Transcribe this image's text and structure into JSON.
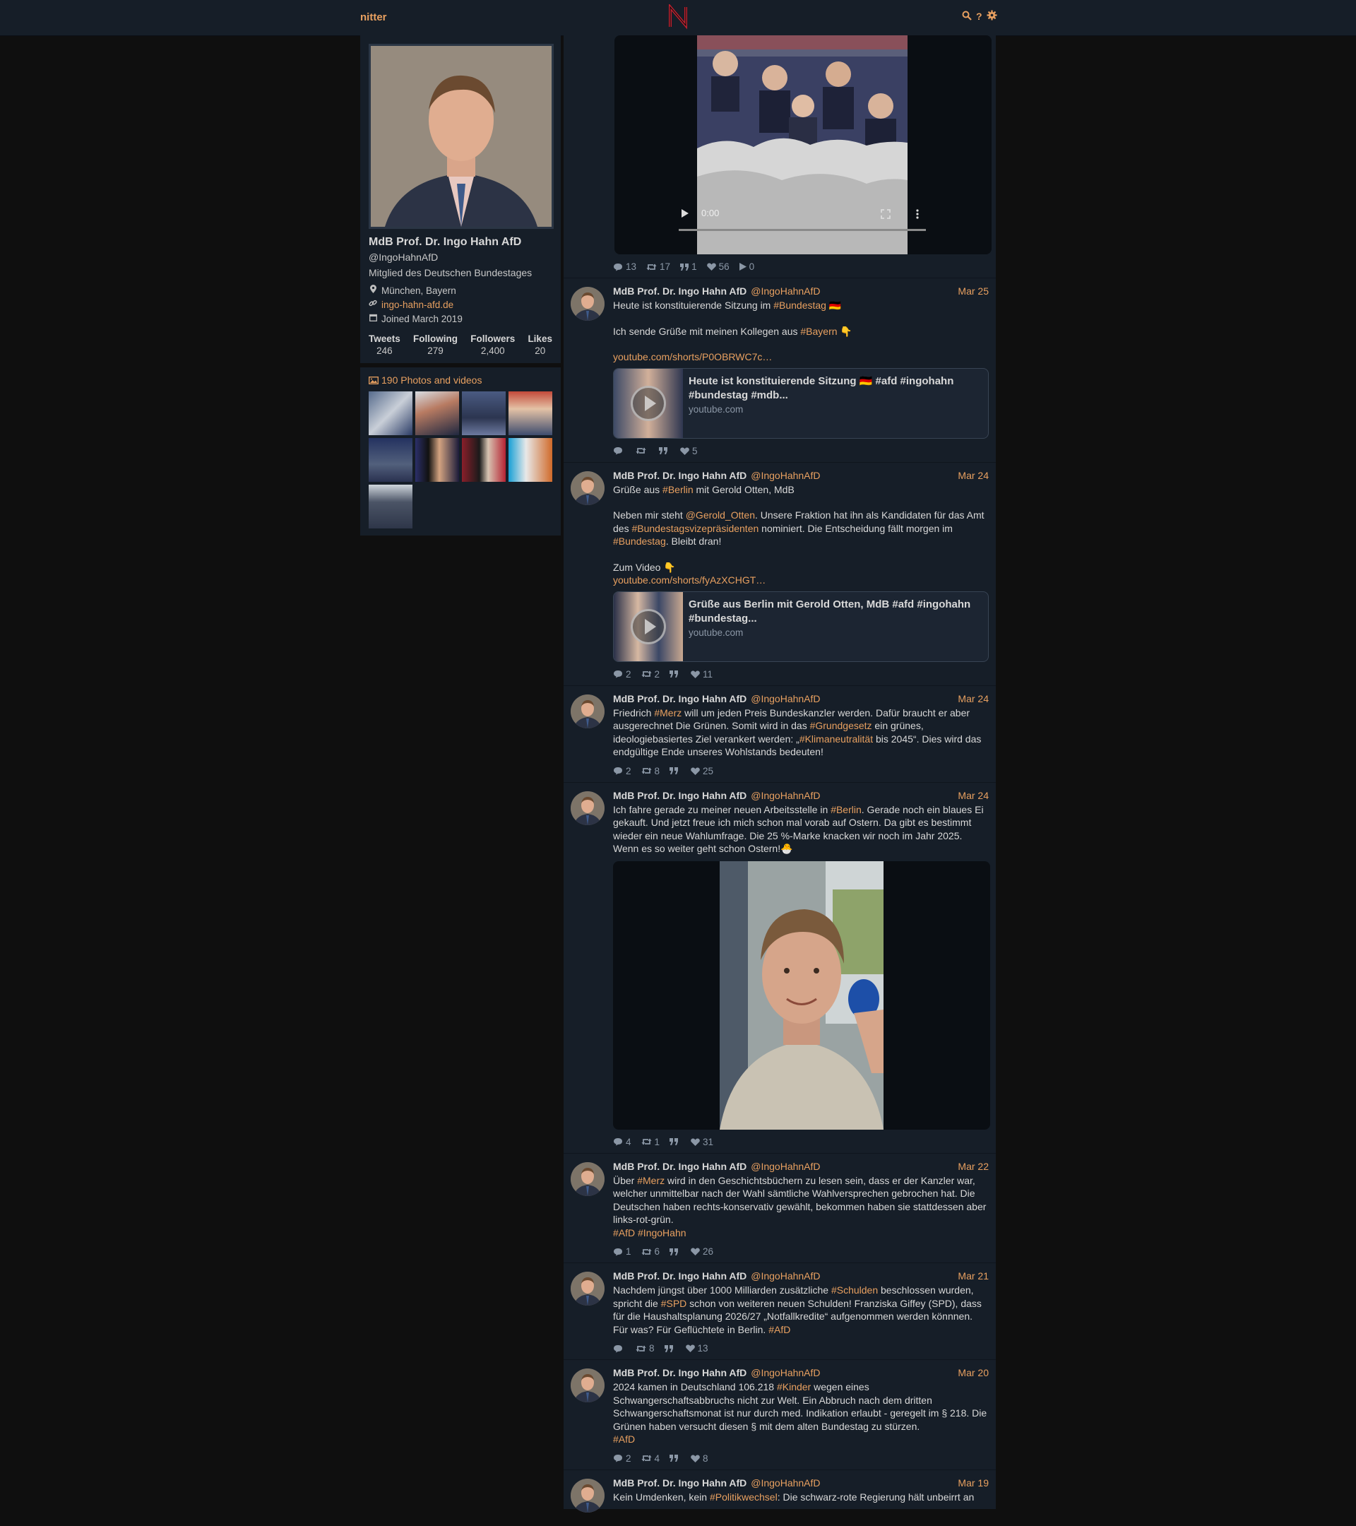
{
  "nav": {
    "brand": "nitter",
    "logo": "N",
    "icons": [
      "search-icon",
      "help-icon",
      "settings-icon"
    ],
    "help_glyph": "?",
    "search_glyph": "🔍",
    "settings_glyph": "⚙"
  },
  "profile": {
    "name": "MdB Prof. Dr. Ingo Hahn AfD",
    "handle": "@IngoHahnAfD",
    "bio": "Mitglied des Deutschen Bundestages",
    "location": "München, Bayern",
    "website": "ingo-hahn-afd.de",
    "joined": "Joined March 2019",
    "stats": [
      {
        "label": "Tweets",
        "value": "246"
      },
      {
        "label": "Following",
        "value": "279"
      },
      {
        "label": "Followers",
        "value": "2,400"
      },
      {
        "label": "Likes",
        "value": "20"
      }
    ],
    "media_title": "190 Photos and videos"
  },
  "video_tweet": {
    "time": "0:00",
    "stats": {
      "replies": "13",
      "retweets": "17",
      "quotes": "1",
      "likes": "56",
      "plays": "0"
    }
  },
  "tweets": [
    {
      "name": "MdB Prof. Dr. Ingo Hahn AfD",
      "handle": "@IngoHahnAfD",
      "date": "Mar 25",
      "p1": "Heute ist konstituierende Sitzung im ",
      "p1_tag": "#Bundestag",
      "p1_end": " 🇩🇪",
      "p2": "Ich sende Grüße mit meinen Kollegen aus ",
      "p2_tag": "#Bayern",
      "p2_end": " 👇",
      "link": "youtube.com/shorts/P0OBRWC7c…",
      "card_title": "Heute ist konstituierende Sitzung 🇩🇪 #afd #ingohahn #bundestag #mdb...",
      "card_domain": "youtube.com",
      "stats": {
        "replies": "",
        "retweets": "",
        "quotes": "",
        "likes": "5"
      }
    },
    {
      "name": "MdB Prof. Dr. Ingo Hahn AfD",
      "handle": "@IngoHahnAfD",
      "date": "Mar 24",
      "p1": "Grüße aus ",
      "p1_tag": "#Berlin",
      "p1_end": " mit Gerold Otten, MdB",
      "p2a": "Neben mir steht ",
      "p2_mention": "@Gerold_Otten",
      "p2b": ". Unsere Fraktion hat ihn als Kandidaten für das Amt des ",
      "p2_tag": "#Bundestagsvizepräsidenten",
      "p2c": " nominiert. Die Entscheidung fällt morgen im ",
      "p2_tag2": "#Bundestag",
      "p2d": ". Bleibt dran!",
      "p3": "Zum Video 👇",
      "link": "youtube.com/shorts/fyAzXCHGT…",
      "card_title": "Grüße aus Berlin mit Gerold Otten, MdB #afd #ingohahn #bundestag...",
      "card_domain": "youtube.com",
      "stats": {
        "replies": "2",
        "retweets": "2",
        "quotes": "",
        "likes": "11"
      }
    },
    {
      "name": "MdB Prof. Dr. Ingo Hahn AfD",
      "handle": "@IngoHahnAfD",
      "date": "Mar 24",
      "t1": "Friedrich ",
      "tag1": "#Merz",
      "t2": " will um jeden Preis Bundeskanzler werden. Dafür braucht er aber ausgerechnet Die Grünen. Somit wird in das ",
      "tag2": "#Grundgesetz",
      "t3": " ein grünes, ideologiebasiertes Ziel verankert werden: „",
      "tag3": "#Klimaneutralität",
      "t4": " bis 2045“. Dies wird das endgültige Ende unseres Wohlstands bedeuten!",
      "stats": {
        "replies": "2",
        "retweets": "8",
        "quotes": "",
        "likes": "25"
      }
    },
    {
      "name": "MdB Prof. Dr. Ingo Hahn AfD",
      "handle": "@IngoHahnAfD",
      "date": "Mar 24",
      "t1": "Ich fahre gerade zu meiner neuen Arbeitsstelle in ",
      "tag1": "#Berlin",
      "t2": ". Gerade noch ein blaues Ei gekauft. Und jetzt freue ich mich schon mal vorab auf Ostern. Da gibt es bestimmt wieder ein neue Wahlumfrage. Die 25 %-Marke knacken wir noch im Jahr 2025. Wenn es so weiter geht schon Ostern!🐣",
      "stats": {
        "replies": "4",
        "retweets": "1",
        "quotes": "",
        "likes": "31"
      }
    },
    {
      "name": "MdB Prof. Dr. Ingo Hahn AfD",
      "handle": "@IngoHahnAfD",
      "date": "Mar 22",
      "t1": "Über ",
      "tag1": "#Merz",
      "t2": " wird in den Geschichtsbüchern zu lesen sein, dass er der Kanzler war, welcher unmittelbar nach der Wahl sämtliche Wahlversprechen gebrochen hat. Die Deutschen haben rechts-konservativ gewählt, bekommen haben sie stattdessen aber links-rot-grün.",
      "tags_line": "#AfD #IngoHahn",
      "stats": {
        "replies": "1",
        "retweets": "6",
        "quotes": "",
        "likes": "26"
      }
    },
    {
      "name": "MdB Prof. Dr. Ingo Hahn AfD",
      "handle": "@IngoHahnAfD",
      "date": "Mar 21",
      "t1": "Nachdem jüngst über 1000 Milliarden zusätzliche ",
      "tag1": "#Schulden",
      "t2": " beschlossen wurden, spricht die ",
      "tag2": "#SPD",
      "t3": " schon von weiteren neuen Schulden! Franziska Giffey (SPD), dass für die Haushaltsplanung 2026/27 „Notfallkredite“ aufgenommen werden könnnen. Für was? Für Geflüchtete in Berlin. ",
      "tag3": "#AfD",
      "stats": {
        "replies": "",
        "retweets": "8",
        "quotes": "",
        "likes": "13"
      }
    },
    {
      "name": "MdB Prof. Dr. Ingo Hahn AfD",
      "handle": "@IngoHahnAfD",
      "date": "Mar 20",
      "t1": "2024 kamen in Deutschland 106.218 ",
      "tag1": "#Kinder",
      "t2": " wegen eines Schwangerschaftsabbruchs nicht zur Welt. Ein Abbruch nach dem dritten Schwangerschaftsmonat ist nur durch med. Indikation erlaubt - geregelt im § 218. Die Grünen haben versucht diesen § mit dem alten Bundestag zu stürzen.",
      "tags_line": "#AfD",
      "stats": {
        "replies": "2",
        "retweets": "4",
        "quotes": "",
        "likes": "8"
      }
    },
    {
      "name": "MdB Prof. Dr. Ingo Hahn AfD",
      "handle": "@IngoHahnAfD",
      "date": "Mar 19",
      "t1": "Kein Umdenken, kein ",
      "tag1": "#Politikwechsel",
      "t2": ": Die schwarz-rote Regierung hält unbeirrt an"
    }
  ],
  "colors": {
    "accent": "#e8a060",
    "bg": "#0f0f0f",
    "panel": "#161e28"
  }
}
